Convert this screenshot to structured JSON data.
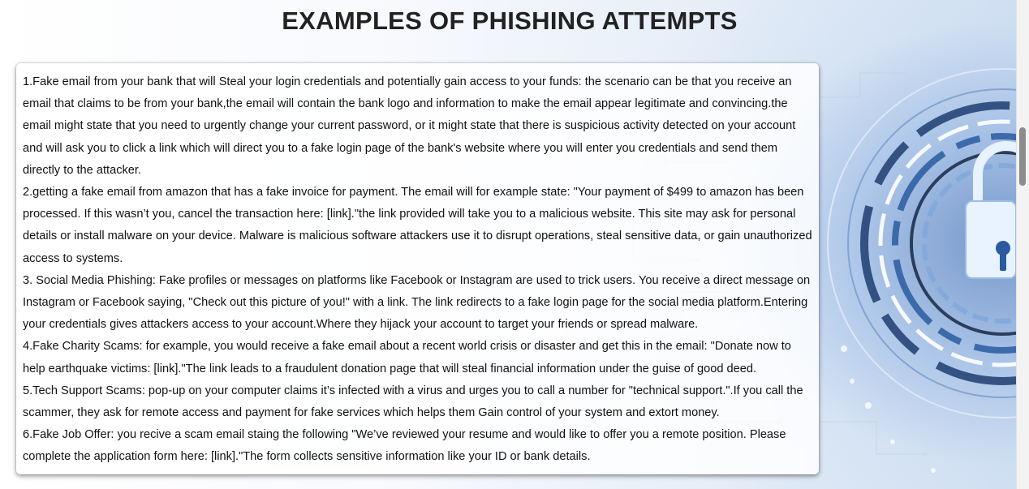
{
  "page": {
    "title": "EXAMPLES OF PHISHING ATTEMPTS"
  },
  "content": {
    "paragraphs": [
      "1.Fake email from your bank that will Steal your login credentials and potentially gain access to your funds: the scenario can be that you receive an email that claims to be from your bank,the email will contain the bank logo and information to make the email appear legitimate and convincing.the email might state that you need to urgently change your current password, or it might state that there is suspicious activity detected on your account and will ask you to click a link which will direct you to a fake login page of the bank's website where you will enter you credentials and send them directly to the attacker.",
      "2.getting a fake email from amazon that has a fake invoice for payment. The email will for example state: \"Your payment of $499 to amazon has been processed. If this wasn’t you, cancel the transaction here: [link].\"the link provided will take you to a malicious website. This site may ask for personal details or install malware on your device. Malware is malicious software attackers use it to disrupt operations, steal sensitive data, or gain unauthorized access to systems.",
      "3. Social Media Phishing: Fake profiles or messages on platforms like Facebook or Instagram are used to trick users. You receive a direct message on Instagram or Facebook saying, \"Check out this picture of you!\" with a link. The link redirects to a fake login page for the social media platform.Entering your credentials gives attackers access to your account.Where they hijack your account to target your friends or spread malware.",
      "4.Fake Charity Scams: for example, you would receive a fake email about a recent world crisis or disaster and get this in the email: \"Donate now to help earthquake victims: [link].\"The link leads to a fraudulent donation page that will steal financial information under the guise of good deed.",
      "5.Tech Support Scams: pop-up on your computer claims it’s infected with a virus and urges you to call a number for \"technical support.\".If you call the scammer, they ask for remote access and payment for fake services which helps them Gain control of your system and extort money.",
      "6.Fake Job Offer: you recive a scam email staing the following \"We’ve reviewed your resume and would like to offer you a remote position. Please complete the application form here: [link].\"The form collects sensitive information like your ID or bank details."
    ]
  },
  "background": {
    "image": "security-lock-icon",
    "accent": "#1f4f99"
  },
  "colors": {
    "title": "#222222",
    "text": "#111111",
    "card_bg": "#ffffff"
  }
}
